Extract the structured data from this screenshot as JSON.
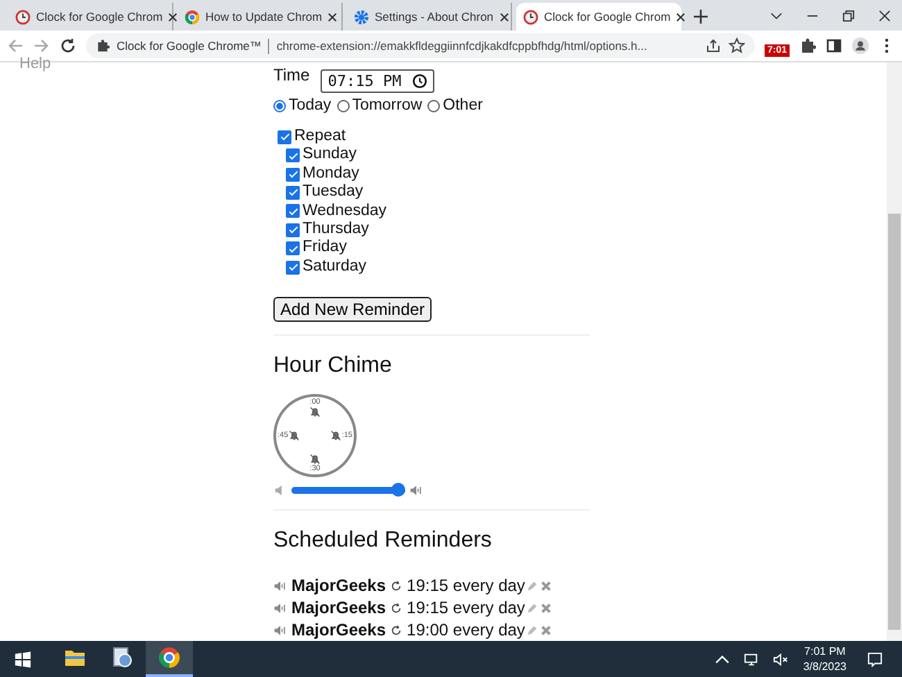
{
  "tabs": [
    {
      "title": "Clock for Google Chrom",
      "kind": "clock",
      "selected": false
    },
    {
      "title": "How to Update Chrom",
      "kind": "chrome",
      "selected": false
    },
    {
      "title": "Settings - About Chron",
      "kind": "gear",
      "selected": false
    },
    {
      "title": "Clock for Google Chrom",
      "kind": "clock",
      "selected": true
    }
  ],
  "address": {
    "site_label": "Clock for Google Chrome™",
    "url": "chrome-extension://emakkfldeggiinnfcdjkakdfcppbfhdg/html/options.h..."
  },
  "extension_badge": "7:01",
  "sidebar_link": "Help",
  "reminder_form": {
    "time_label": "Time",
    "time_value": "07:15 PM",
    "when": [
      {
        "label": "Today",
        "selected": true
      },
      {
        "label": "Tomorrow",
        "selected": false
      },
      {
        "label": "Other",
        "selected": false
      }
    ],
    "repeat": {
      "label": "Repeat",
      "checked": true
    },
    "days": [
      {
        "label": "Sunday",
        "checked": true
      },
      {
        "label": "Monday",
        "checked": true
      },
      {
        "label": "Tuesday",
        "checked": true
      },
      {
        "label": "Wednesday",
        "checked": true
      },
      {
        "label": "Thursday",
        "checked": true
      },
      {
        "label": "Friday",
        "checked": true
      },
      {
        "label": "Saturday",
        "checked": true
      }
    ],
    "add_button": "Add New Reminder"
  },
  "hour_chime": {
    "heading": "Hour Chime",
    "marks": [
      ":00",
      ":15",
      ":30",
      ":45"
    ],
    "volume": {
      "level": 1
    }
  },
  "scheduled": {
    "heading": "Scheduled Reminders",
    "items": [
      {
        "name": "MajorGeeks",
        "schedule": "19:15 every day"
      },
      {
        "name": "MajorGeeks",
        "schedule": "19:15 every day"
      },
      {
        "name": "MajorGeeks",
        "schedule": "19:00 every day"
      }
    ]
  },
  "taskbar": {
    "apps": [
      {
        "kind": "explorer",
        "active": false
      },
      {
        "kind": "app",
        "active": false
      },
      {
        "kind": "chrome",
        "active": true
      }
    ],
    "time": "7:01 PM",
    "date": "3/8/2023"
  }
}
